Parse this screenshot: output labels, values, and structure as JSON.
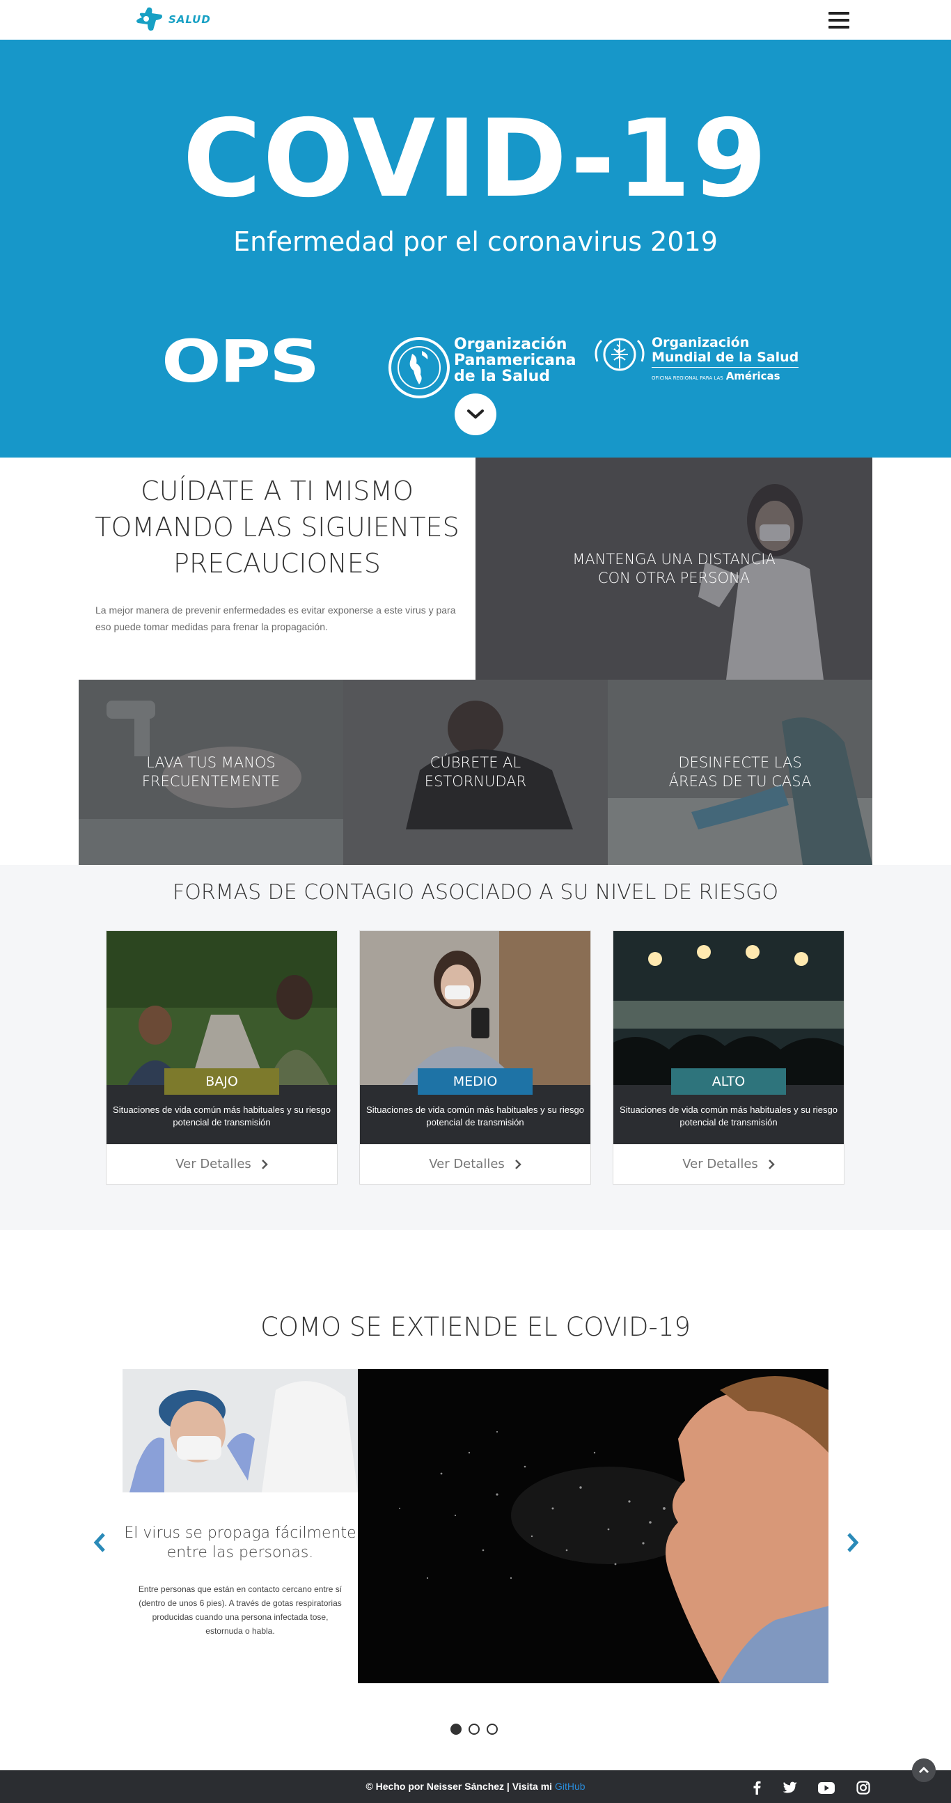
{
  "navbar": {
    "brand_text": "SALUD",
    "menu_icon": "hamburger-menu-icon"
  },
  "hero": {
    "title": "COVID-19",
    "subtitle": "Enfermedad por el coronavirus 2019",
    "ops_logo": "OPS",
    "paho_name": [
      "Organización",
      "Panamericana",
      "de la Salud"
    ],
    "who_name": [
      "Organización",
      "Mundial de la Salud"
    ],
    "who_regional_small": "OFICINA REGIONAL PARA LAS",
    "who_regional": "Américas",
    "scroll_icon": "chevron-down-icon"
  },
  "precautions": {
    "title": "CUÍDATE A TI MISMO TOMANDO LAS SIGUIENTES PRECAUCIONES",
    "description": "La mejor manera de prevenir enfermedades es evitar exponerse a este virus y para eso puede tomar medidas para frenar la propagación.",
    "tiles": {
      "distance": "MANTENGA UNA DISTANCIA CON OTRA PERSONA",
      "hands": "LAVA TUS MANOS FRECUENTEMENTE",
      "sneeze": "CÚBRETE AL ESTORNUDAR",
      "disinfect": "DESINFECTE LAS ÁREAS DE TU CASA"
    }
  },
  "risk": {
    "title": "FORMAS DE CONTAGIO ASOCIADO A SU NIVEL DE RIESGO",
    "cards": [
      {
        "level": "BAJO",
        "color": "#7d7a2c",
        "text": "Situaciones de vida común más habituales y su riesgo potencial de transmisión",
        "link": "Ver Detalles"
      },
      {
        "level": "MEDIO",
        "color": "#1e73a6",
        "text": "Situaciones de vida común más habituales y su riesgo potencial de transmisión",
        "link": "Ver Detalles"
      },
      {
        "level": "ALTO",
        "color": "#2e747c",
        "text": "Situaciones de vida común más habituales y su riesgo potencial de transmisión",
        "link": "Ver Detalles"
      }
    ]
  },
  "spread": {
    "title": "COMO SE EXTIENDE EL COVID-19",
    "slide_title": "El virus se propaga fácilmente entre las personas.",
    "slide_text": "Entre personas que están en contacto cercano entre sí (dentro de unos 6 pies). A través de gotas respiratorias producidas cuando una persona infectada tose, estornuda o habla.",
    "active_slide": 1,
    "slide_count": 3
  },
  "footer": {
    "made_by": "© Hecho por Neisser Sánchez | Visita mi ",
    "github": "GitHub",
    "social_icons": [
      "facebook-icon",
      "twitter-icon",
      "youtube-icon",
      "instagram-icon"
    ]
  },
  "colors": {
    "hero_bg": "#1797c9",
    "brand": "#17a0c4",
    "dark": "#2b2d31",
    "link": "#2a8bd8"
  }
}
